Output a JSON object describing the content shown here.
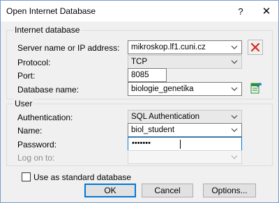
{
  "window": {
    "title": "Open Internet Database",
    "help_glyph": "?",
    "close_glyph": "✕"
  },
  "internet_db": {
    "group_label": "Internet database",
    "server_label": "Server name or IP address:",
    "server_value": "mikroskop.lf1.cuni.cz",
    "protocol_label": "Protocol:",
    "protocol_value": "TCP",
    "port_label": "Port:",
    "port_value": "8085",
    "dbname_label": "Database name:",
    "dbname_value": "biologie_genetika"
  },
  "user": {
    "group_label": "User",
    "auth_label": "Authentication:",
    "auth_value": "SQL Authentication",
    "name_label": "Name:",
    "name_value": "biol_student",
    "password_label": "Password:",
    "password_value": "•••••••",
    "logon_label": "Log on to:",
    "logon_value": ""
  },
  "standard_db_label": "Use as standard database",
  "standard_db_checked": false,
  "buttons": {
    "ok": "OK",
    "cancel": "Cancel",
    "options": "Options..."
  },
  "icons": {
    "delete": "red-x-icon",
    "database": "database-icon",
    "dropdown": "chevron-down-icon"
  },
  "colors": {
    "focus_border": "#0078d7",
    "delete_red": "#d62a1e",
    "db_green": "#2f8f3a"
  }
}
